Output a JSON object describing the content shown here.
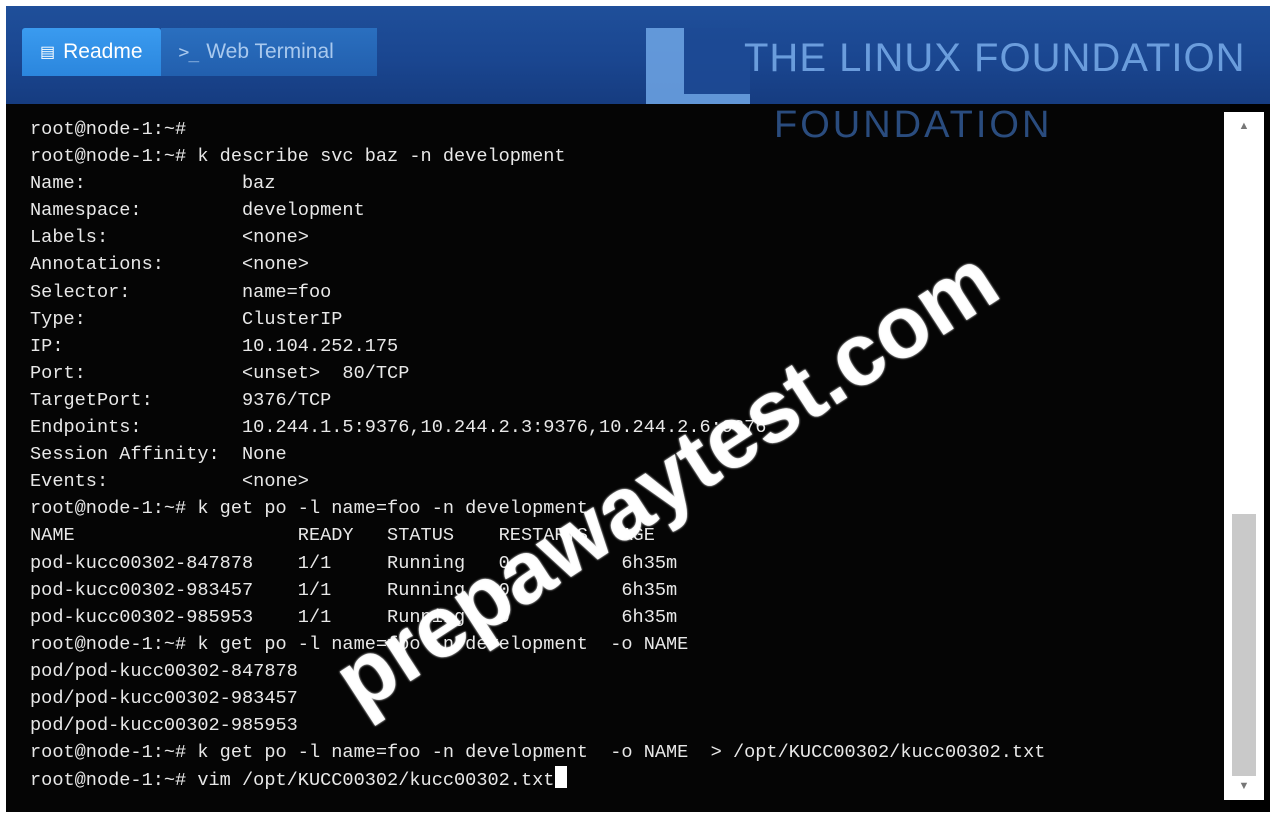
{
  "tabs": [
    {
      "label": "Readme",
      "icon": "book-icon",
      "active": true
    },
    {
      "label": "Web Terminal",
      "icon": "terminal-prompt-icon",
      "active": false
    }
  ],
  "branding": {
    "line1": "THE LINUX FOUNDATION",
    "line2": "FOUNDATION"
  },
  "terminal": {
    "lines": [
      "root@node-1:~#",
      "root@node-1:~# k describe svc baz -n development",
      "Name:              baz",
      "Namespace:         development",
      "Labels:            <none>",
      "Annotations:       <none>",
      "Selector:          name=foo",
      "Type:              ClusterIP",
      "IP:                10.104.252.175",
      "Port:              <unset>  80/TCP",
      "TargetPort:        9376/TCP",
      "Endpoints:         10.244.1.5:9376,10.244.2.3:9376,10.244.2.6:9376",
      "Session Affinity:  None",
      "Events:            <none>",
      "root@node-1:~# k get po -l name=foo -n development",
      "NAME                    READY   STATUS    RESTARTS   AGE",
      "pod-kucc00302-847878    1/1     Running   0          6h35m",
      "pod-kucc00302-983457    1/1     Running   0          6h35m",
      "pod-kucc00302-985953    1/1     Running   0          6h35m",
      "root@node-1:~# k get po -l name=foo -n development  -o NAME",
      "pod/pod-kucc00302-847878",
      "pod/pod-kucc00302-983457",
      "pod/pod-kucc00302-985953",
      "root@node-1:~# k get po -l name=foo -n development  -o NAME  > /opt/KUCC00302/kucc00302.txt",
      "root@node-1:~# vim /opt/KUCC00302/kucc00302.txt"
    ]
  },
  "watermark": "prepawaytest.com",
  "scrollbar": {
    "up": "▲",
    "down": "▼"
  }
}
